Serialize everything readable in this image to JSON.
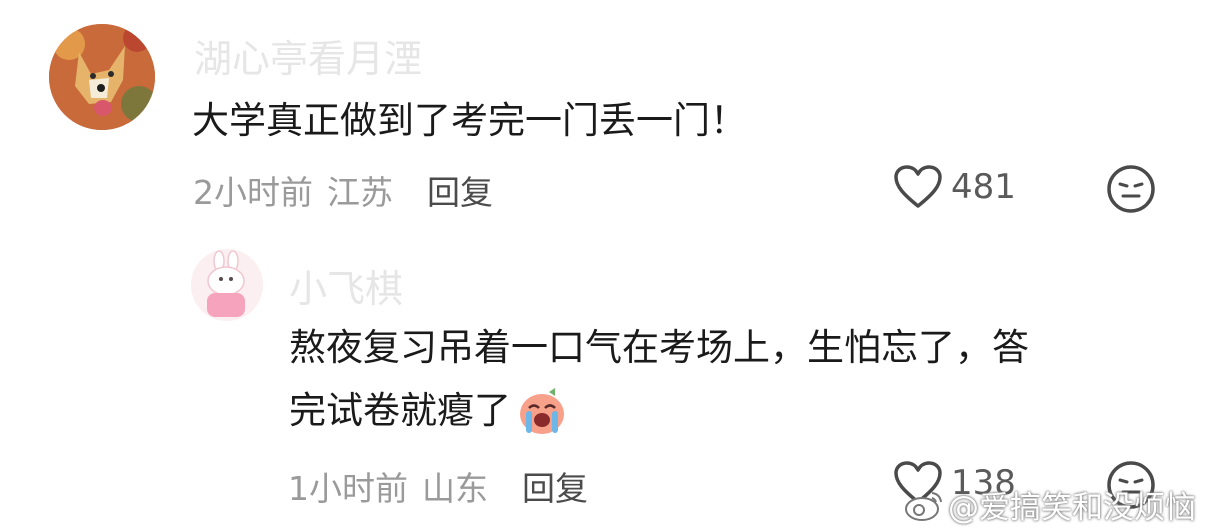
{
  "comments": [
    {
      "author": "湖心亭看月湮",
      "text": "大学真正做到了考完一门丢一门！",
      "time": "2小时前",
      "location": "江苏",
      "reply_label": "回复",
      "likes": "481"
    }
  ],
  "reply": {
    "author": "小飞棋",
    "text_line1": "熬夜复习吊着一口气在考场上，生怕忘了，答",
    "text_line2": "完试卷就瘪了",
    "time": "1小时前",
    "location": "山东",
    "reply_label": "回复",
    "likes": "138"
  },
  "watermark": "@爱搞笑和没烦恼",
  "icons": {
    "like": "heart-icon",
    "dislike": "neutral-face-icon",
    "emoji": "crying-emoji-icon"
  }
}
